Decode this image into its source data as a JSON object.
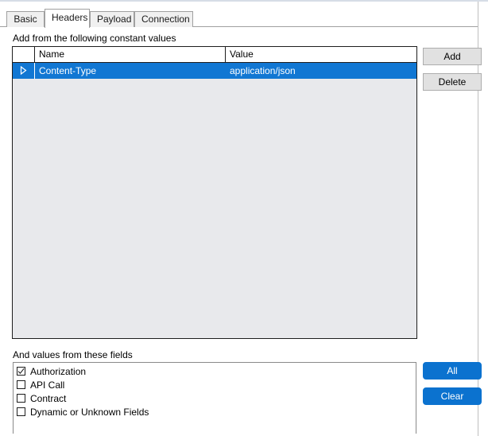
{
  "theme": {
    "accent": "#0b72cf",
    "selection": "#1177d3",
    "grid_background": "#e8e9ec",
    "page_background": "#ffffff",
    "button_face": "#e1e1e1",
    "border": "#1d1d1d"
  },
  "tabs": [
    {
      "label": "Basic",
      "selected": false
    },
    {
      "label": "Headers",
      "selected": true
    },
    {
      "label": "Payload",
      "selected": false
    },
    {
      "label": "Connection",
      "selected": false
    }
  ],
  "constants_section": {
    "label": "Add from the following constant values",
    "grid": {
      "columns": [
        "",
        "Name",
        "Value"
      ],
      "row_marker_icon": "current-row-triangle-icon",
      "rows": [
        {
          "name": "Content-Type",
          "value": "application/json",
          "selected": true
        }
      ]
    },
    "buttons": {
      "add": "Add",
      "delete": "Delete"
    }
  },
  "fields_section": {
    "label": "And values from these fields",
    "items": [
      {
        "label": "Authorization",
        "checked": true
      },
      {
        "label": "API Call",
        "checked": false
      },
      {
        "label": "Contract",
        "checked": false
      },
      {
        "label": "Dynamic or Unknown Fields",
        "checked": false
      }
    ],
    "buttons": {
      "all": "All",
      "clear": "Clear"
    }
  }
}
